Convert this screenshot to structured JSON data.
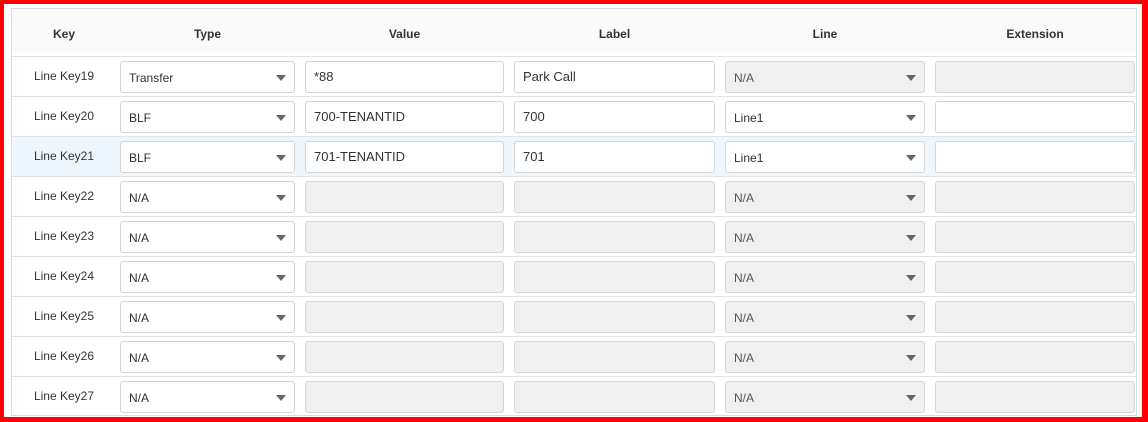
{
  "table": {
    "headers": {
      "key": "Key",
      "type": "Type",
      "value": "Value",
      "label": "Label",
      "line": "Line",
      "extension": "Extension"
    },
    "rows": [
      {
        "key": "Line Key19",
        "type": "Transfer",
        "value": "*88",
        "label": "Park Call",
        "line": "N/A",
        "extension": ""
      },
      {
        "key": "Line Key20",
        "type": "BLF",
        "value": "700-TENANTID",
        "label": "700",
        "line": "Line1",
        "extension": ""
      },
      {
        "key": "Line Key21",
        "type": "BLF",
        "value": "701-TENANTID",
        "label": "701",
        "line": "Line1",
        "extension": ""
      },
      {
        "key": "Line Key22",
        "type": "N/A",
        "value": "",
        "label": "",
        "line": "N/A",
        "extension": ""
      },
      {
        "key": "Line Key23",
        "type": "N/A",
        "value": "",
        "label": "",
        "line": "N/A",
        "extension": ""
      },
      {
        "key": "Line Key24",
        "type": "N/A",
        "value": "",
        "label": "",
        "line": "N/A",
        "extension": ""
      },
      {
        "key": "Line Key25",
        "type": "N/A",
        "value": "",
        "label": "",
        "line": "N/A",
        "extension": ""
      },
      {
        "key": "Line Key26",
        "type": "N/A",
        "value": "",
        "label": "",
        "line": "N/A",
        "extension": ""
      },
      {
        "key": "Line Key27",
        "type": "N/A",
        "value": "",
        "label": "",
        "line": "N/A",
        "extension": ""
      }
    ]
  }
}
